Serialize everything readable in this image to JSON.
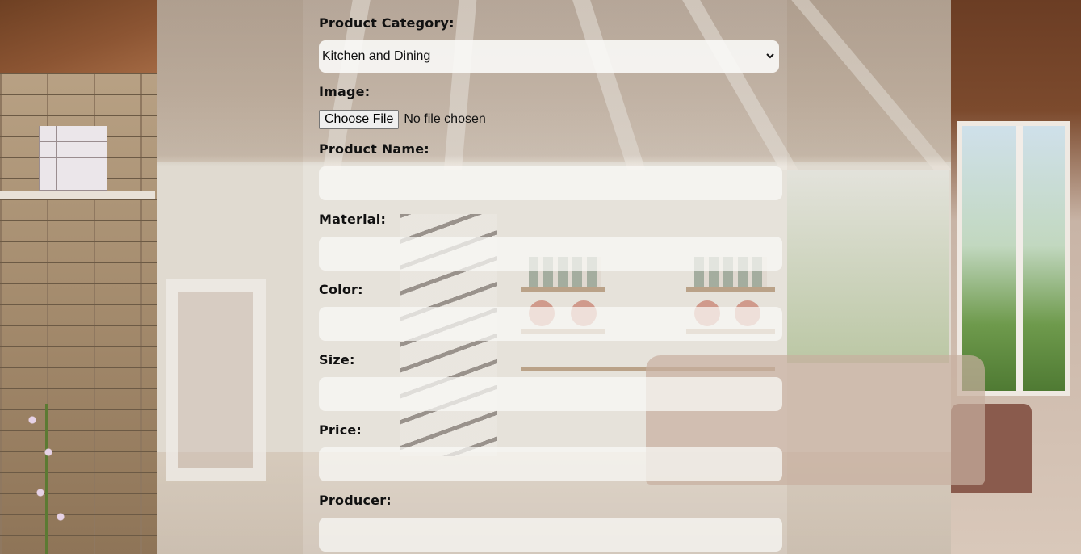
{
  "form": {
    "category_label": "Product Category:",
    "category_value": "Kitchen and Dining",
    "image_label": "Image:",
    "file_button": "Choose File",
    "file_status": "No file chosen",
    "product_name_label": "Product Name:",
    "material_label": "Material:",
    "color_label": "Color:",
    "size_label": "Size:",
    "price_label": "Price:",
    "producer_label": "Producer:"
  },
  "icons": {
    "select_arrow": "chevron-down-icon"
  },
  "colors": {
    "panel_overlay": "#ebe8e2",
    "input_bg": "#faf9f7",
    "label_text": "#111111"
  }
}
